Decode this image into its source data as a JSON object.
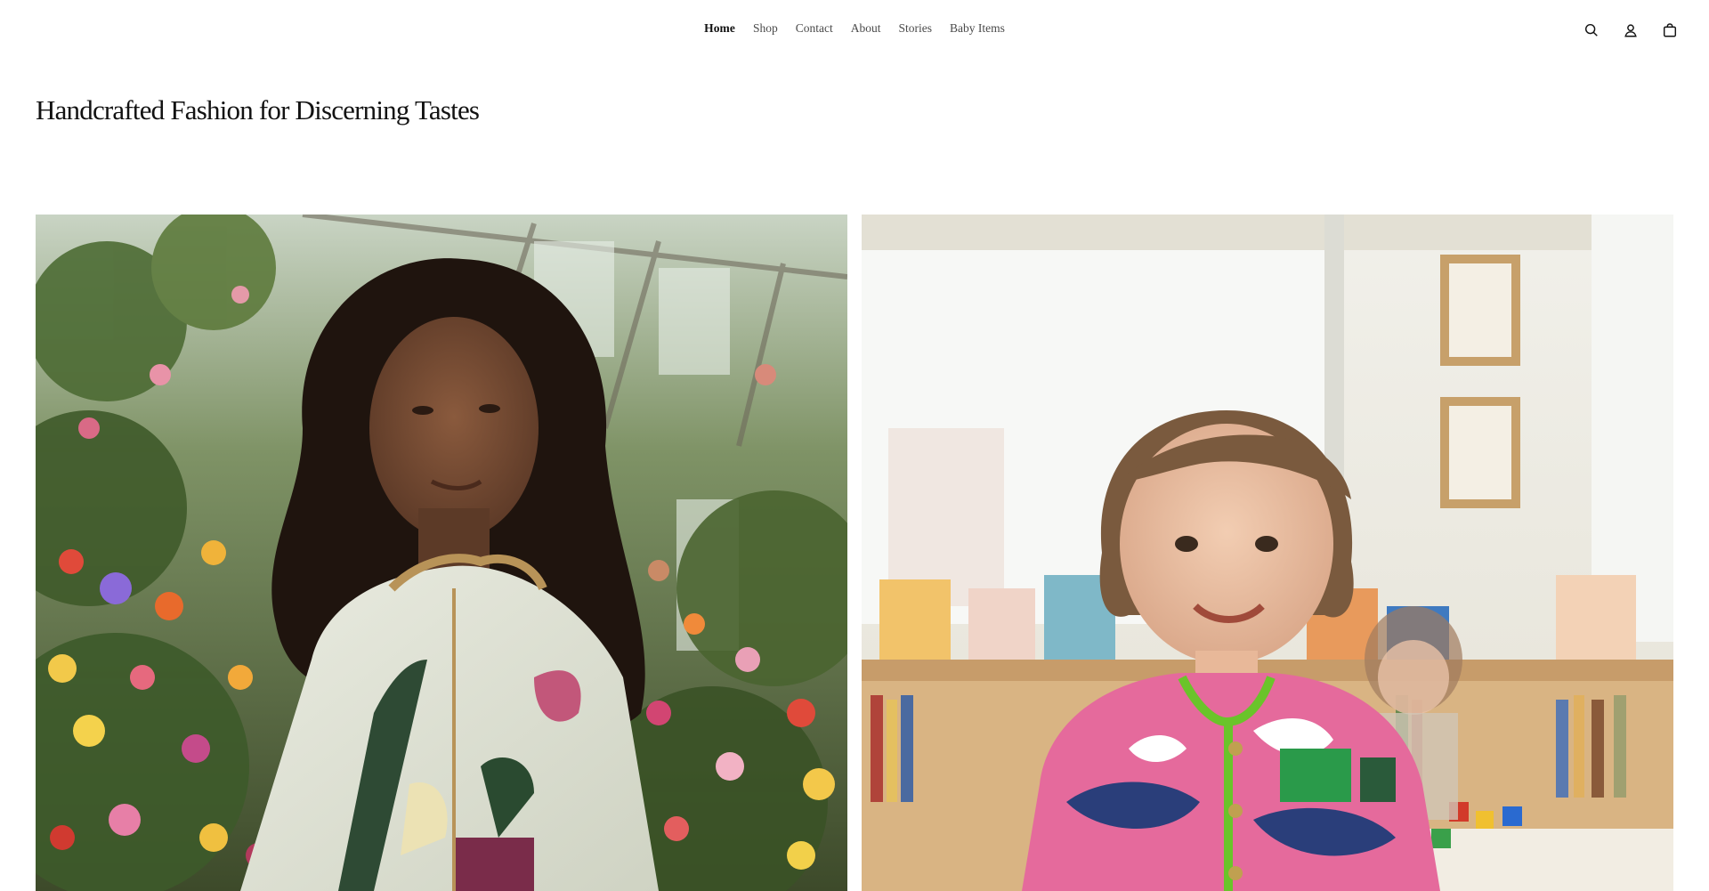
{
  "nav": {
    "items": [
      {
        "label": "Home",
        "active": true
      },
      {
        "label": "Shop",
        "active": false
      },
      {
        "label": "Contact",
        "active": false
      },
      {
        "label": "About",
        "active": false
      },
      {
        "label": "Stories",
        "active": false
      },
      {
        "label": "Baby Items",
        "active": false
      }
    ]
  },
  "header_icons": [
    "search-icon",
    "account-icon",
    "cart-icon"
  ],
  "hero": {
    "title": "Handcrafted Fashion for Discerning Tastes"
  },
  "gallery": {
    "images": [
      {
        "subject": "woman-in-quilted-jacket-greenhouse"
      },
      {
        "subject": "child-in-pink-quilted-jacket-classroom"
      }
    ]
  },
  "colors": {
    "text": "#121212",
    "nav_text": "#4a4a4a",
    "background": "#ffffff"
  }
}
